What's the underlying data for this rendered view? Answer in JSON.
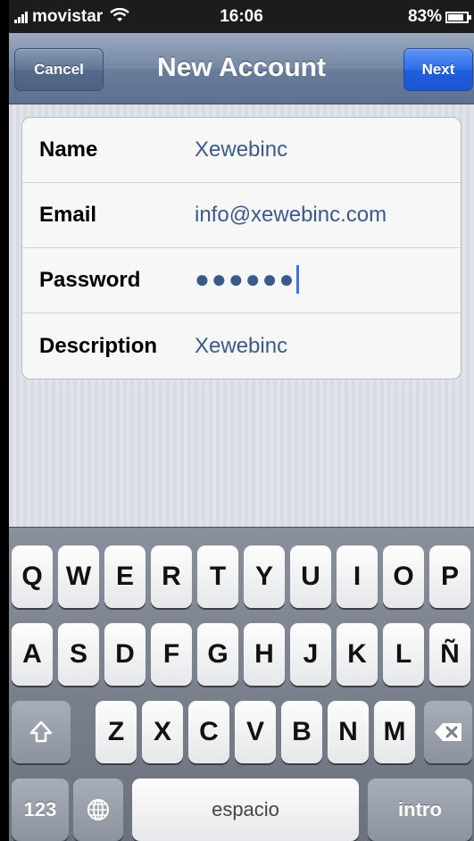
{
  "status_bar": {
    "carrier": "movistar",
    "time": "16:06",
    "battery": "83%"
  },
  "nav": {
    "title": "New Account",
    "cancel_label": "Cancel",
    "next_label": "Next"
  },
  "form": {
    "rows": [
      {
        "label": "Name",
        "value": "Xewebinc"
      },
      {
        "label": "Email",
        "value": "info@xewebinc.com"
      },
      {
        "label": "Password",
        "value": "●●●●●●"
      },
      {
        "label": "Description",
        "value": "Xewebinc"
      }
    ]
  },
  "keyboard": {
    "row1": [
      "Q",
      "W",
      "E",
      "R",
      "T",
      "Y",
      "U",
      "I",
      "O",
      "P"
    ],
    "row2": [
      "A",
      "S",
      "D",
      "F",
      "G",
      "H",
      "J",
      "K",
      "L",
      "Ñ"
    ],
    "row3": [
      "Z",
      "X",
      "C",
      "V",
      "B",
      "N",
      "M"
    ],
    "numbers_label": "123",
    "space_label": "espacio",
    "return_label": "intro",
    "shift_icon": "shift-arrow-icon",
    "delete_icon": "backspace-icon",
    "globe_icon": "globe-icon"
  }
}
